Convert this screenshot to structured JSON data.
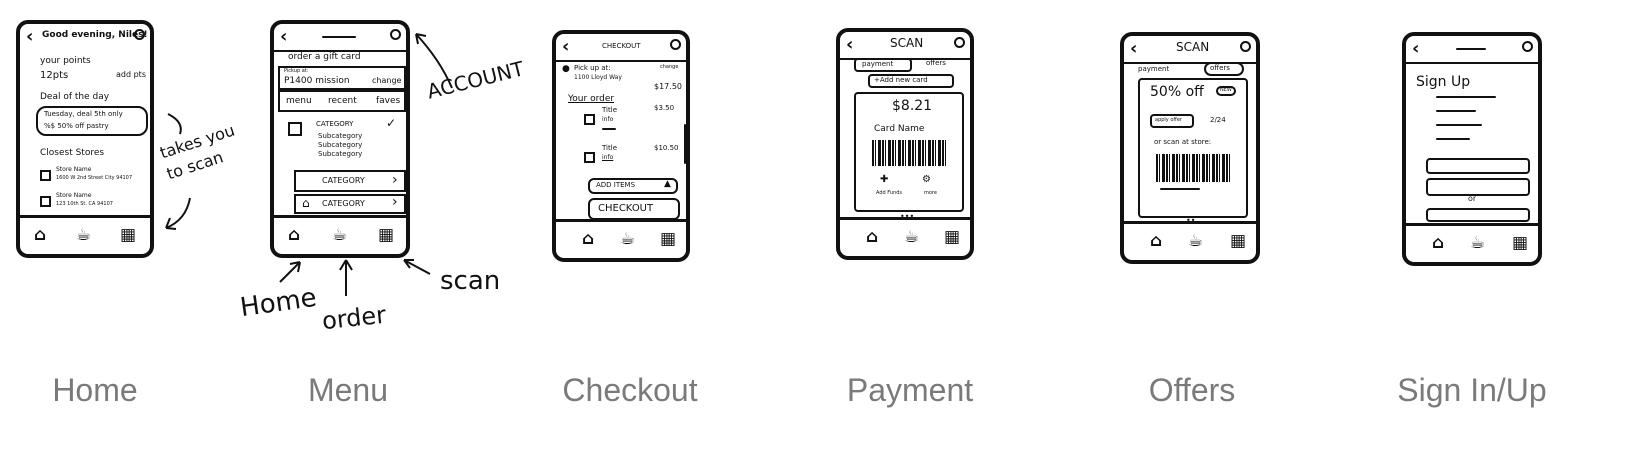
{
  "screens": [
    {
      "caption": "Home"
    },
    {
      "caption": "Menu"
    },
    {
      "caption": "Checkout"
    },
    {
      "caption": "Payment"
    },
    {
      "caption": "Offers"
    },
    {
      "caption": "Sign In/Up"
    }
  ],
  "home": {
    "greeting": "Good evening, Niles!",
    "points_label": "your points",
    "points_value": "12pts",
    "points_extra": "add pts",
    "deal_title": "Deal of the day",
    "deal_line1": "Tuesday, deal 5th only",
    "deal_line2": "%$ 50% off pastry",
    "stores_title": "Closest Stores",
    "store1_name": "Store Name",
    "store1_addr": "1600 W 2nd Street City 94107",
    "store2_name": "Store Name",
    "store2_addr": "123 10th St. CA 94107",
    "annotation": "takes you to scan"
  },
  "menu": {
    "gift": "order a gift card",
    "pickup_label": "Pickup at:",
    "pickup_value": "P1400 mission",
    "change": "change",
    "tabs": [
      "menu",
      "recent",
      "faves"
    ],
    "category1": "CATEGORY",
    "subcats": [
      "Subcategory",
      "Subcategory",
      "Subcategory"
    ],
    "category2": "CATEGORY",
    "category3": "CATEGORY",
    "annot_account": "ACCOUNT",
    "annot_home": "Home",
    "annot_order": "order",
    "annot_scan": "scan"
  },
  "checkout": {
    "title": "CHECKOUT",
    "pickup_label": "Pick up at:",
    "pickup_addr": "1100 Lloyd Way",
    "change": "change",
    "total": "$17.50",
    "your_order": "Your order",
    "item1_title": "Title",
    "item1_info": "info",
    "item1_price": "$3.50",
    "item2_title": "Title",
    "item2_info": "info",
    "item2_price": "$10.50",
    "add_items": "ADD ITEMS",
    "checkout_btn": "CHECKOUT"
  },
  "payment": {
    "title": "SCAN",
    "tab_payment": "payment",
    "tab_offers": "offers",
    "add_card": "+Add new card",
    "amount": "$8.21",
    "card_name": "Card Name",
    "add_funds": "Add Funds",
    "more": "more"
  },
  "offers": {
    "title": "SCAN",
    "tab_payment": "payment",
    "tab_offers": "offers",
    "offer_text": "50% off",
    "new_badge": "NEW",
    "apply_btn": "apply offer",
    "date": "2/24",
    "or_scan": "or scan at store:"
  },
  "signup": {
    "title": "Sign Up",
    "or": "or"
  }
}
